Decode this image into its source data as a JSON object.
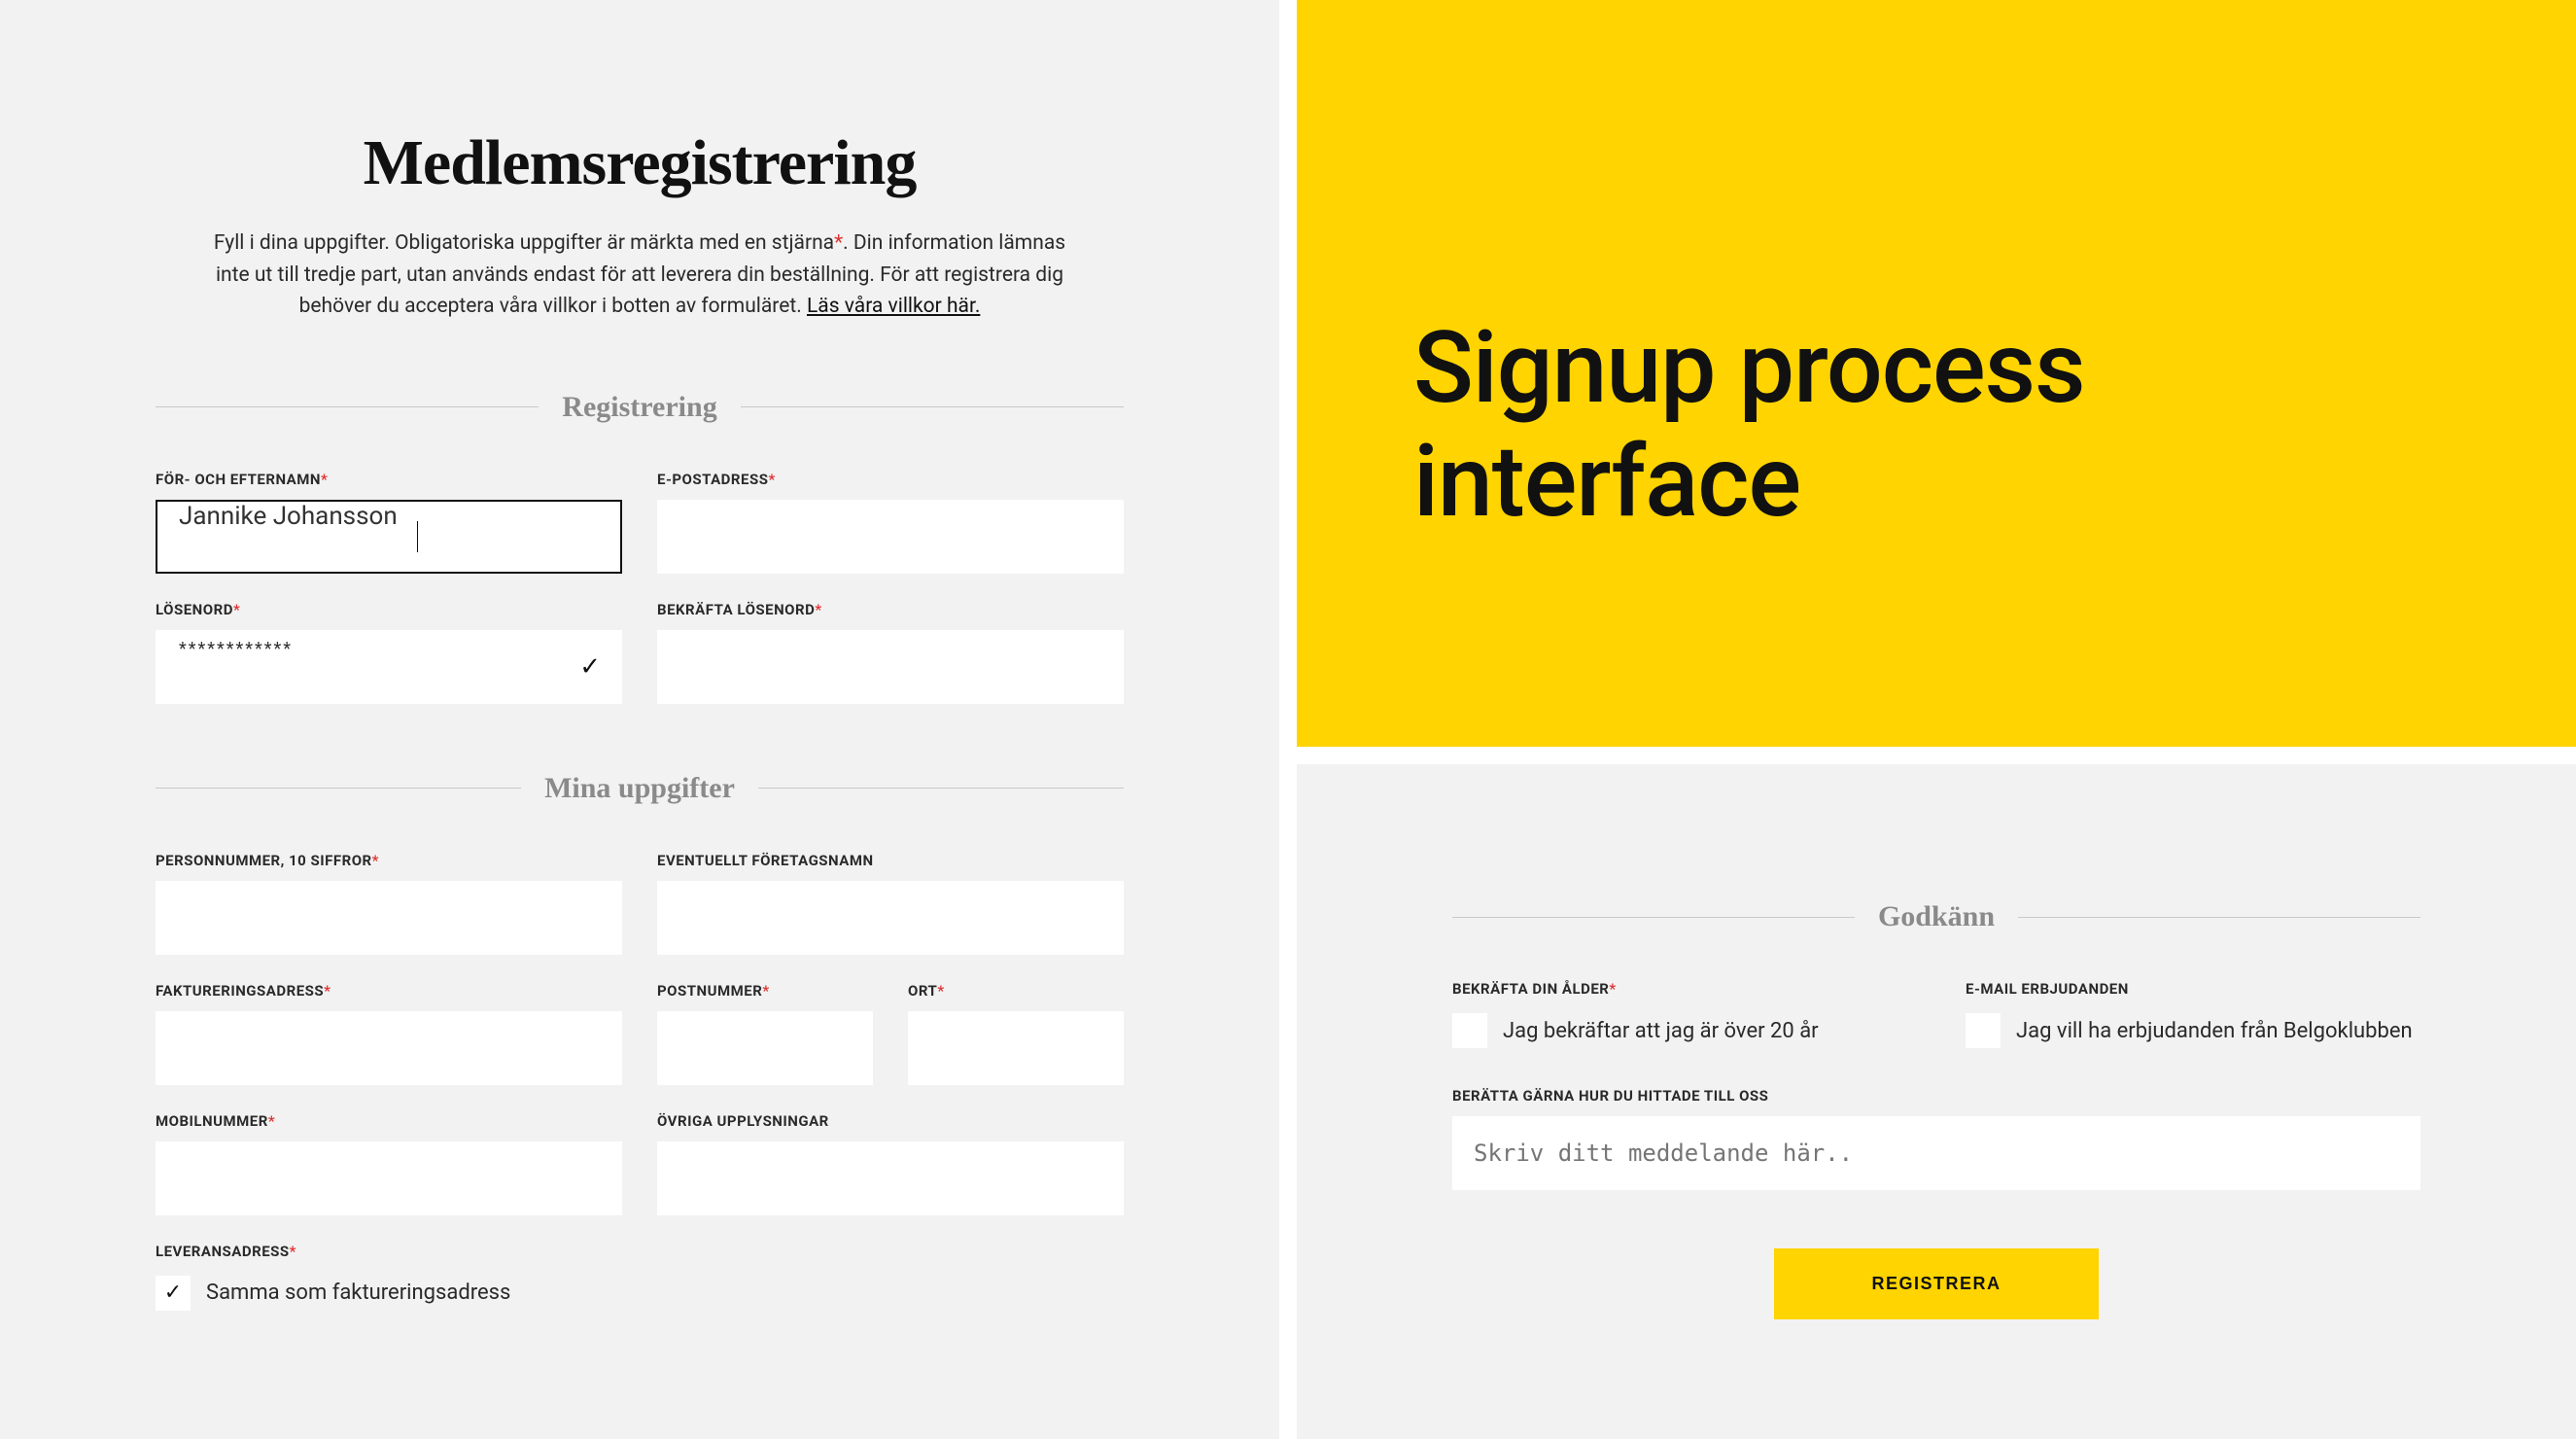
{
  "left": {
    "page_title": "Medlemsregistrering",
    "intro_part1": "Fyll i dina uppgifter. Obligatoriska uppgifter är märkta med en stjärna",
    "intro_star": "*",
    "intro_part2": ". Din information lämnas inte ut till tredje part, utan används endast för att leverera din beställning. För att registrera dig behöver du acceptera våra villkor i botten av formuläret. ",
    "intro_link": "Läs våra villkor här.",
    "section_registration": "Registrering",
    "section_details": "Mina uppgifter",
    "fields": {
      "name_label": "FÖR- OCH EFTERNAMN",
      "name_value": "Jannike Johansson",
      "email_label": "E-POSTADRESS",
      "email_value": "",
      "password_label": "LÖSENORD",
      "password_value": "************",
      "password_confirm_label": "BEKRÄFTA LÖSENORD",
      "password_confirm_value": "",
      "personnr_label": "PERSONNUMMER, 10 SIFFROR",
      "personnr_value": "",
      "company_label": "EVENTUELLT FÖRETAGSNAMN",
      "company_value": "",
      "billing_label": "FAKTURERINGSADRESS",
      "billing_value": "",
      "postal_label": "POSTNUMMER",
      "postal_value": "",
      "city_label": "ORT",
      "city_value": "",
      "mobile_label": "MOBILNUMMER",
      "mobile_value": "",
      "other_label": "ÖVRIGA UPPLYSNINGAR",
      "other_value": "",
      "delivery_label": "LEVERANSADRESS",
      "delivery_checkbox_label": "Samma som faktureringsadress",
      "delivery_checked": true
    }
  },
  "right_top": {
    "heading": "Signup process interface"
  },
  "right_bottom": {
    "section_approve": "Godkänn",
    "age_label": "BEKRÄFTA DIN ÅLDER",
    "age_checkbox_label": "Jag bekräftar att jag är över 20 år",
    "email_offers_label": "E-MAIL ERBJUDANDEN",
    "email_offers_checkbox_label": "Jag vill ha erbjudanden från Belgoklubben",
    "howfound_label": "BERÄTTA GÄRNA HUR DU HITTADE TILL OSS",
    "howfound_placeholder": "Skriv ditt meddelande här..",
    "submit_label": "REGISTRERA"
  }
}
